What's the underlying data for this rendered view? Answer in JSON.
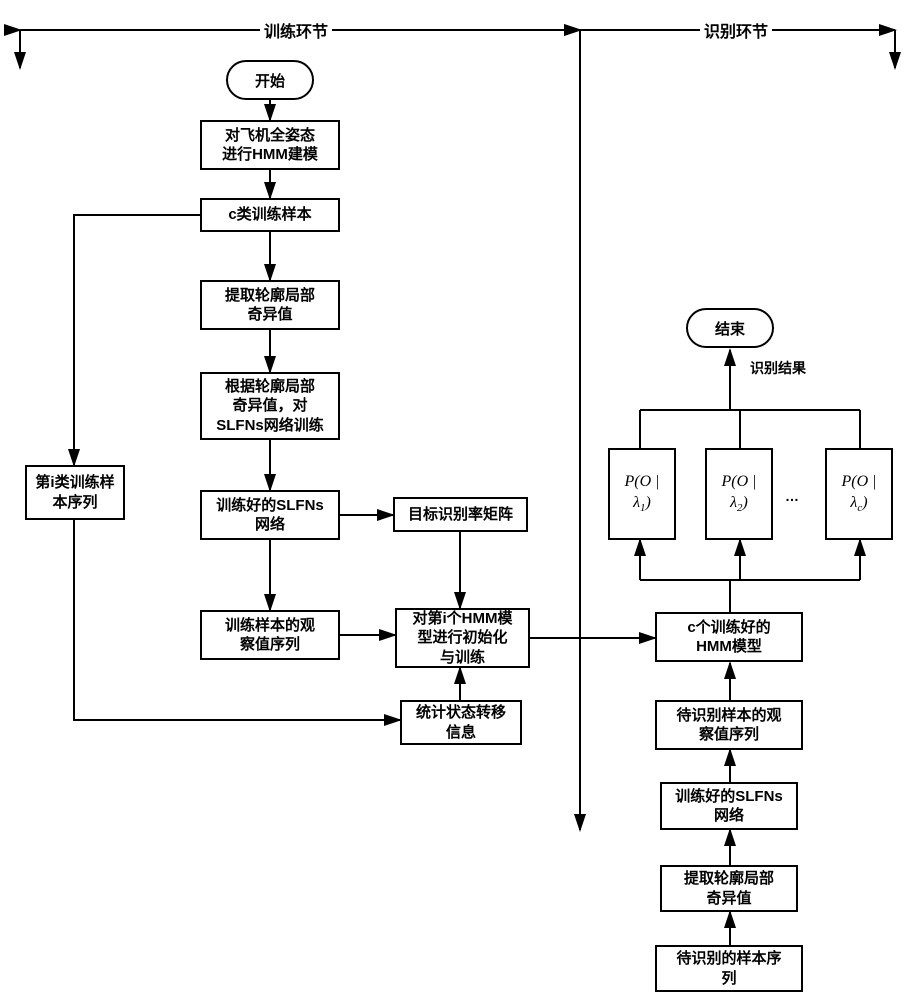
{
  "sections": {
    "training": "训练环节",
    "recognition": "识别环节"
  },
  "nodes": {
    "start": "开始",
    "hmm_model": "对飞机全姿态\n进行HMM建模",
    "c_samples": "c类训练样本",
    "extract_sv": "提取轮廓局部\n奇异值",
    "train_slfns": "根据轮廓局部\n奇异值，对\nSLFNs网络训练",
    "class_i_seq": "第i类训练样\n本序列",
    "trained_slfns": "训练好的SLFNs\n网络",
    "recog_matrix": "目标识别率矩阵",
    "obs_seq": "训练样本的观\n察值序列",
    "init_train_hmm": "对第i个HMM模\n型进行初始化\n与训练",
    "state_trans": "统计状态转移\n信息",
    "c_hmm": "c个训练好的\nHMM模型",
    "test_obs_seq": "待识别样本的观\n察值序列",
    "trained_slfns2": "训练好的SLFNs\n网络",
    "extract_sv2": "提取轮廓局部\n奇异值",
    "test_seq": "待识别的样本序\n列",
    "end": "结束",
    "result_label": "识别结果",
    "prob1": "P(O | λ₁)",
    "prob2": "P(O | λ₂)",
    "probc": "P(O | λ_c)",
    "ellipsis": "…"
  }
}
